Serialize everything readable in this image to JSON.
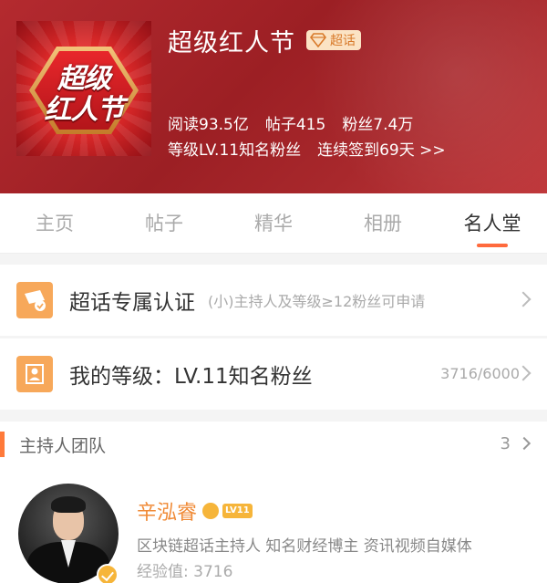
{
  "header": {
    "cover_line1": "超级",
    "cover_line2": "红人节",
    "title": "超级红人节",
    "badge": "超话",
    "stats": {
      "read": "阅读93.5亿",
      "posts": "帖子415",
      "fans": "粉丝7.4万"
    },
    "level": "等级LV.11知名粉丝",
    "checkin": "连续签到69天 >>"
  },
  "tabs": [
    {
      "label": "主页",
      "active": false
    },
    {
      "label": "帖子",
      "active": false
    },
    {
      "label": "精华",
      "active": false
    },
    {
      "label": "相册",
      "active": false
    },
    {
      "label": "名人堂",
      "active": true
    }
  ],
  "rows": {
    "cert": {
      "label": "超话专属认证",
      "sub": "(小)主持人及等级≥12粉丝可申请",
      "icon": "certification-icon"
    },
    "level": {
      "label": "我的等级：LV.11知名粉丝",
      "value": "3716/6000",
      "icon": "level-icon"
    }
  },
  "hosts": {
    "title": "主持人团队",
    "count": "3",
    "first": {
      "name": "辛泓睿",
      "level_badge": "LV11",
      "desc": "区块链超话主持人 知名财经博主 资讯视频自媒体",
      "exp": "经验值: 3716"
    }
  },
  "colors": {
    "header_bg": "#a8262b",
    "accent": "#ff6a3d",
    "icon_orange": "#f7a85a",
    "name_orange": "#f08a36"
  }
}
